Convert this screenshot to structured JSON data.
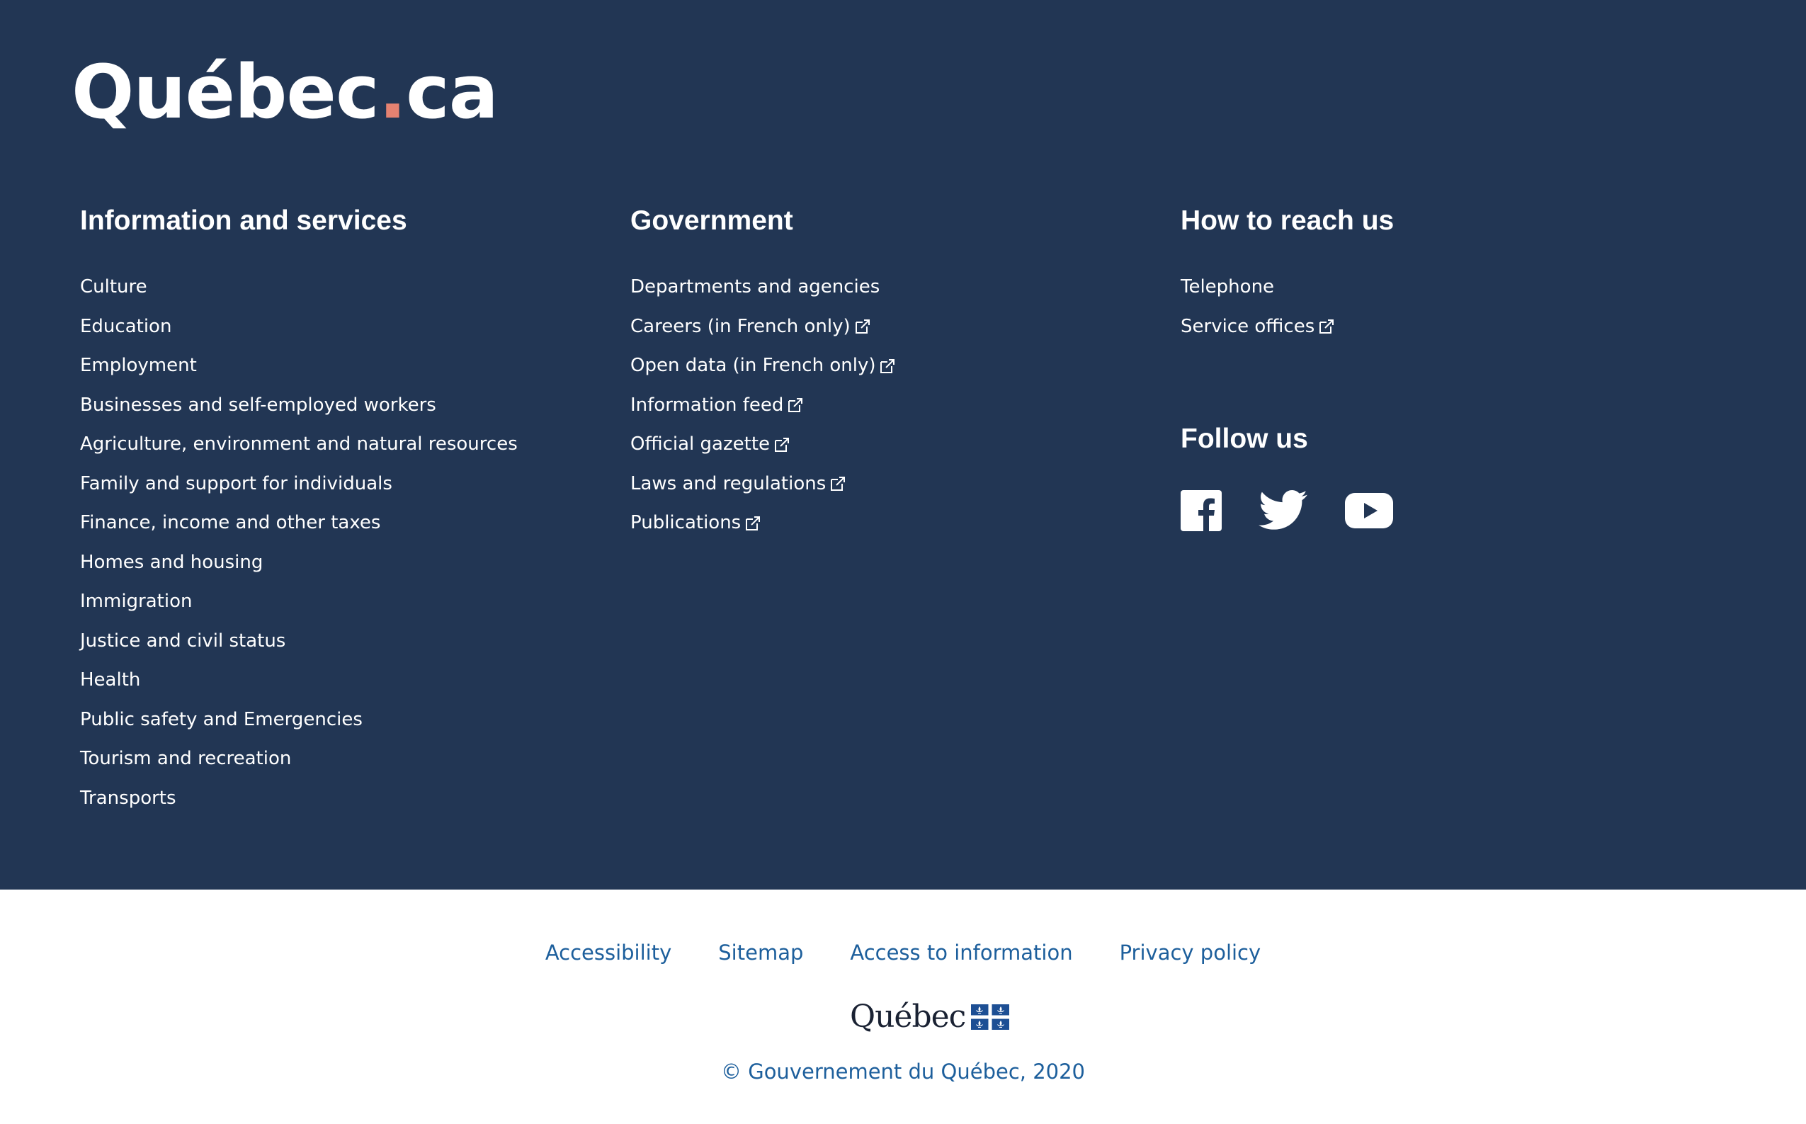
{
  "brand": {
    "logo_main": "Québec",
    "logo_dot": ".",
    "logo_suffix": "ca",
    "accent_color": "#e58271",
    "background_color": "#223654"
  },
  "columns": {
    "info": {
      "title": "Information and services",
      "items": [
        {
          "label": "Culture"
        },
        {
          "label": "Education"
        },
        {
          "label": "Employment"
        },
        {
          "label": "Businesses and self-employed workers"
        },
        {
          "label": "Agriculture, environment and natural resources"
        },
        {
          "label": "Family and support for individuals"
        },
        {
          "label": "Finance, income and other taxes"
        },
        {
          "label": "Homes and housing"
        },
        {
          "label": "Immigration"
        },
        {
          "label": "Justice and civil status"
        },
        {
          "label": "Health"
        },
        {
          "label": "Public safety and Emergencies"
        },
        {
          "label": "Tourism and recreation"
        },
        {
          "label": "Transports"
        }
      ]
    },
    "government": {
      "title": "Government",
      "items": [
        {
          "label": "Departments and agencies",
          "external": false
        },
        {
          "label": "Careers (in French only)",
          "external": true
        },
        {
          "label": "Open data (in French only)",
          "external": true
        },
        {
          "label": "Information feed",
          "external": true
        },
        {
          "label": "Official gazette",
          "external": true
        },
        {
          "label": "Laws and regulations",
          "external": true
        },
        {
          "label": "Publications",
          "external": true
        }
      ]
    },
    "reach": {
      "title": "How to reach us",
      "items": [
        {
          "label": "Telephone",
          "external": false
        },
        {
          "label": "Service offices",
          "external": true
        }
      ]
    }
  },
  "follow": {
    "title": "Follow us",
    "networks": [
      "facebook-icon",
      "twitter-icon",
      "youtube-icon"
    ]
  },
  "bottom": {
    "links": [
      "Accessibility",
      "Sitemap",
      "Access to information",
      "Privacy policy"
    ],
    "gov_wordmark": "Québec",
    "copyright": "© Gouvernement du Québec, 2020",
    "link_color": "#1d5f9c"
  }
}
